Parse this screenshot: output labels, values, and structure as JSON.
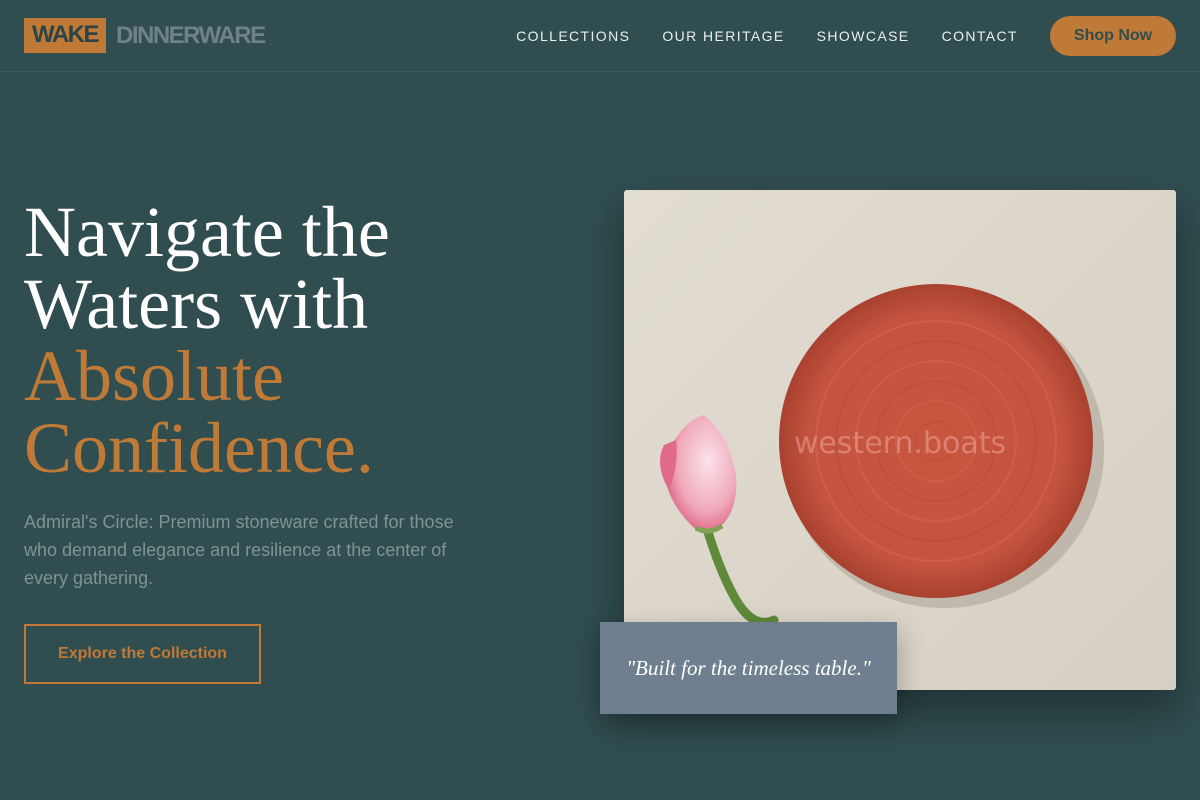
{
  "header": {
    "logo_mark": "WAKE",
    "logo_text": "DINNERWARE",
    "nav": [
      "COLLECTIONS",
      "OUR HERITAGE",
      "SHOWCASE",
      "CONTACT"
    ],
    "shop_label": "Shop Now"
  },
  "hero": {
    "title_line1": "Navigate the",
    "title_line2": "Waters with",
    "title_accent1": "Absolute",
    "title_accent2": "Confidence.",
    "subtitle": "Admiral's Circle: Premium stoneware crafted for those who demand elegance and resilience at the center of every gathering.",
    "cta_label": "Explore the Collection"
  },
  "image": {
    "watermark": "western.boats",
    "quote": "\"Built for the timeless table.\""
  },
  "colors": {
    "background": "#304d4f",
    "accent": "#c07a38",
    "quote_panel": "#6f7f90",
    "plate": "#c4553f"
  }
}
